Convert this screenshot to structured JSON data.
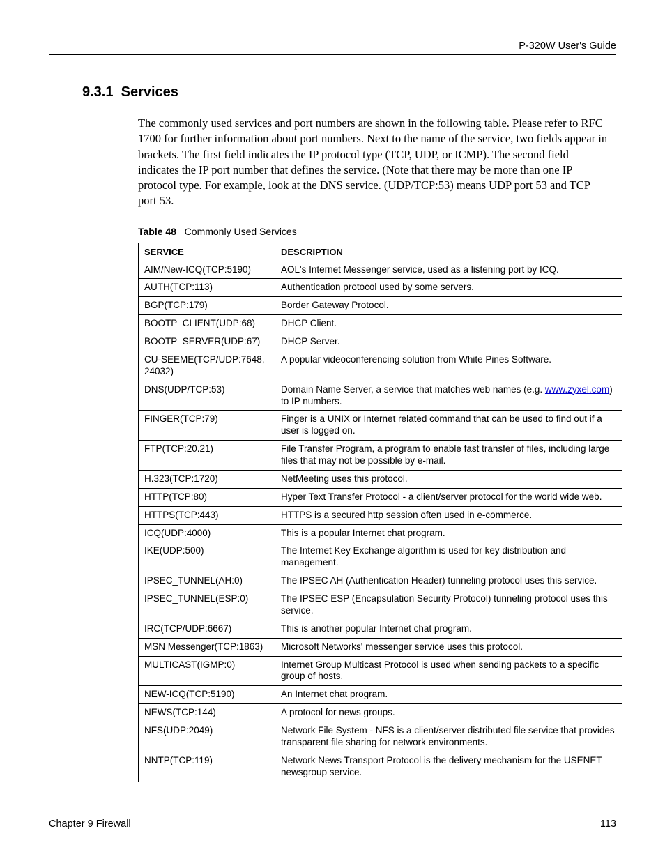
{
  "header": {
    "guide_title": "P-320W User's Guide"
  },
  "section": {
    "number": "9.3.1",
    "title": "Services"
  },
  "intro_paragraph": "The commonly used services and port numbers are shown in the following table. Please refer to RFC 1700 for further information about port numbers. Next to the name of the service, two fields appear in brackets. The first field indicates the IP protocol type (TCP, UDP, or ICMP). The second field indicates the IP port number that defines the service. (Note that there may be more than one IP protocol type. For example, look at the DNS service. (UDP/TCP:53) means UDP port 53 and TCP port 53.",
  "table": {
    "number": "Table 48",
    "title": "Commonly Used Services",
    "columns": [
      "SERVICE",
      "DESCRIPTION"
    ],
    "rows": [
      {
        "service": "AIM/New-ICQ(TCP:5190)",
        "description": "AOL's Internet Messenger service, used as a listening port by ICQ."
      },
      {
        "service": "AUTH(TCP:113)",
        "description": "Authentication protocol used by some servers."
      },
      {
        "service": "BGP(TCP:179)",
        "description": "Border Gateway Protocol."
      },
      {
        "service": "BOOTP_CLIENT(UDP:68)",
        "description": "DHCP Client."
      },
      {
        "service": "BOOTP_SERVER(UDP:67)",
        "description": "DHCP Server."
      },
      {
        "service": "CU-SEEME(TCP/UDP:7648, 24032)",
        "description": "A popular videoconferencing solution from White Pines Software."
      },
      {
        "service": "DNS(UDP/TCP:53)",
        "description_pre": "Domain Name Server, a service that matches web names (e.g. ",
        "link": "www.zyxel.com",
        "description_post": ") to IP numbers."
      },
      {
        "service": "FINGER(TCP:79)",
        "description": "Finger is a UNIX or Internet related command that can be used to find out if a user is logged on."
      },
      {
        "service": "FTP(TCP:20.21)",
        "description": "File Transfer Program, a program to enable fast transfer of files, including large files that may not be possible by e-mail."
      },
      {
        "service": "H.323(TCP:1720)",
        "description": "NetMeeting uses this protocol."
      },
      {
        "service": "HTTP(TCP:80)",
        "description": "Hyper Text Transfer Protocol - a client/server protocol for the world wide web."
      },
      {
        "service": "HTTPS(TCP:443)",
        "description": "HTTPS is a secured http session often used in e-commerce."
      },
      {
        "service": "ICQ(UDP:4000)",
        "description": "This is a popular Internet chat program."
      },
      {
        "service": "IKE(UDP:500)",
        "description": "The Internet Key Exchange algorithm is used for key distribution and management."
      },
      {
        "service": "IPSEC_TUNNEL(AH:0)",
        "description": "The IPSEC AH (Authentication Header) tunneling protocol uses this service."
      },
      {
        "service": "IPSEC_TUNNEL(ESP:0)",
        "description": "The IPSEC ESP (Encapsulation Security Protocol) tunneling protocol uses this service."
      },
      {
        "service": "IRC(TCP/UDP:6667)",
        "description": "This is another popular Internet chat program."
      },
      {
        "service": "MSN Messenger(TCP:1863)",
        "description": "Microsoft Networks' messenger service uses this protocol."
      },
      {
        "service": "MULTICAST(IGMP:0)",
        "description": "Internet Group Multicast Protocol is used when sending packets to a specific group of hosts."
      },
      {
        "service": "NEW-ICQ(TCP:5190)",
        "description": "An Internet chat program."
      },
      {
        "service": "NEWS(TCP:144)",
        "description": "A protocol for news groups."
      },
      {
        "service": "NFS(UDP:2049)",
        "description": "Network File System - NFS is a client/server distributed file service that provides transparent file sharing for network environments."
      },
      {
        "service": "NNTP(TCP:119)",
        "description": "Network News Transport Protocol is the delivery mechanism for the USENET newsgroup service."
      }
    ]
  },
  "footer": {
    "chapter": "Chapter 9 Firewall",
    "page": "113"
  }
}
